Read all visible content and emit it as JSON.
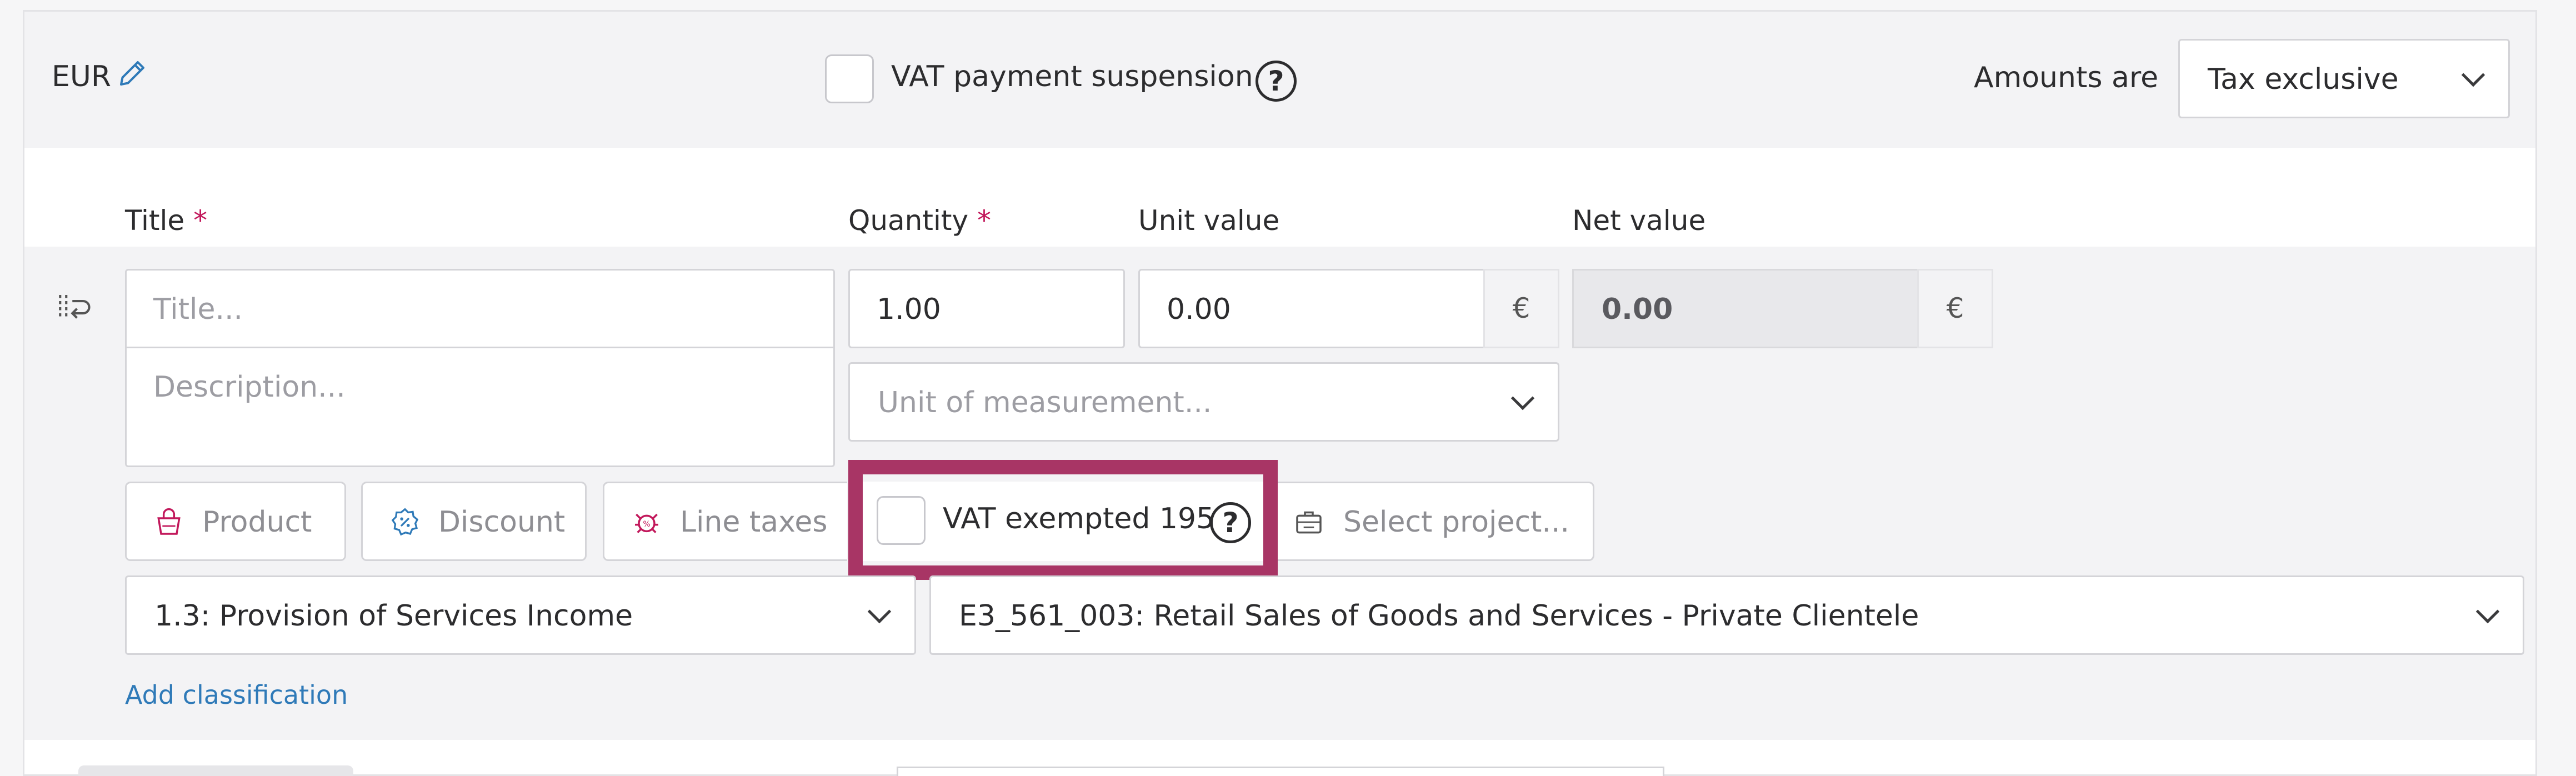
{
  "topbar": {
    "currency": "EUR",
    "vat_suspension_label": "VAT payment suspension",
    "amounts_are_label": "Amounts are",
    "amounts_are_value": "Tax exclusive"
  },
  "columns": {
    "title": "Title",
    "quantity": "Quantity",
    "unit_value": "Unit value",
    "net_value": "Net value",
    "required_mark": "*"
  },
  "line": {
    "title_placeholder": "Title...",
    "description_placeholder": "Description...",
    "quantity": "1.00",
    "unit_value": "0.00",
    "currency_symbol": "€",
    "net_value": "0.00",
    "unit_placeholder": "Unit of measurement...",
    "product_label": "Product",
    "discount_label": "Discount",
    "line_taxes_label": "Line taxes",
    "vat_exempted_label": "VAT exempted 195",
    "project_placeholder": "Select project...",
    "classification_1": "1.3: Provision of Services Income",
    "classification_2": "E3_561_003: Retail Sales of Goods and Services - Private Clientele",
    "add_classification": "Add classification"
  },
  "colors": {
    "accent_link": "#2f7ab8",
    "required": "#c2185b",
    "highlight": "#a83565"
  },
  "icons": {
    "currency_edit": "pencil-icon",
    "help": "question-circle-icon",
    "drag": "reorder-icon",
    "product": "shopping-bag-icon",
    "discount": "discount-badge-icon",
    "line_taxes": "taxes-icon",
    "project": "briefcase-icon",
    "dropdown": "chevron-down-icon"
  }
}
